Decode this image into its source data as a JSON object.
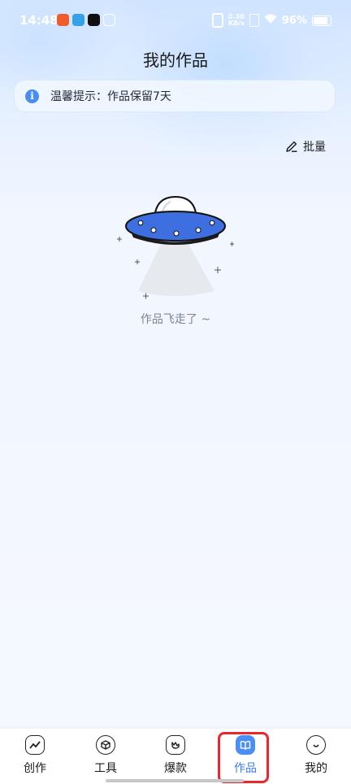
{
  "status_bar": {
    "time": "14:48",
    "net_speed_top": "0.30",
    "net_speed_bottom": "KB/s",
    "battery": "96%"
  },
  "header": {
    "title": "我的作品"
  },
  "notice": {
    "icon": "info-icon",
    "text": "温馨提示：作品保留7天"
  },
  "toolbar": {
    "batch_label": "批量"
  },
  "empty_state": {
    "illustration": "ufo-illustration",
    "text": "作品飞走了 ~"
  },
  "bottom_nav": {
    "items": [
      {
        "label": "创作",
        "icon": "chart-line-icon"
      },
      {
        "label": "工具",
        "icon": "cube-icon"
      },
      {
        "label": "爆款",
        "icon": "trend-icon"
      },
      {
        "label": "作品",
        "icon": "book-icon",
        "active": true
      },
      {
        "label": "我的",
        "icon": "smile-face-icon"
      }
    ]
  },
  "colors": {
    "accent": "#4b8ef5",
    "highlight": "#e8282e",
    "ufo": "#3d6fe0"
  }
}
